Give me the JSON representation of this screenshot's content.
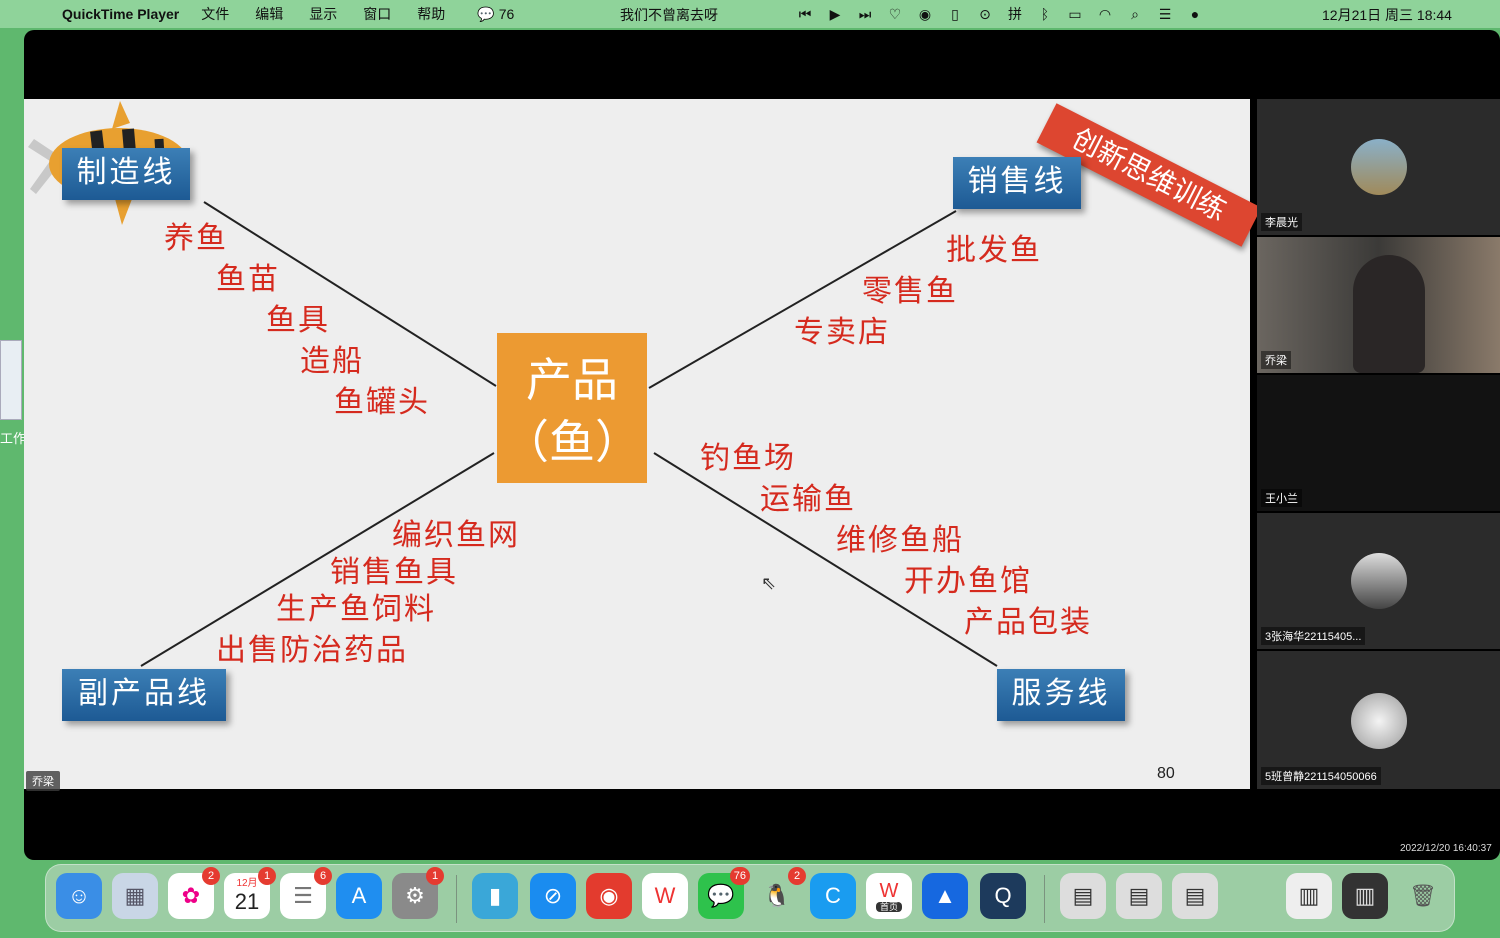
{
  "menubar": {
    "app_name": "QuickTime Player",
    "menus": [
      "文件",
      "编辑",
      "显示",
      "窗口",
      "帮助"
    ],
    "wechat_count": "76",
    "song_title": "我们不曾离去呀",
    "clock": "12月21日 周三  18:44"
  },
  "desktop": {
    "side_label": "工作"
  },
  "slide": {
    "banner": "创新思维训练",
    "center_title": "产品",
    "center_subtitle": "（鱼）",
    "page_number": "80",
    "speaker_tag": "乔梁",
    "manufacturing": {
      "label": "制造线",
      "items": [
        "养鱼",
        "鱼苗",
        "鱼具",
        "造船",
        "鱼罐头"
      ]
    },
    "sales": {
      "label": "销售线",
      "items": [
        "批发鱼",
        "零售鱼",
        "专卖店"
      ]
    },
    "byproduct": {
      "label": "副产品线",
      "items": [
        "编织鱼网",
        "销售鱼具",
        "生产鱼饲料",
        "出售防治药品"
      ]
    },
    "service": {
      "label": "服务线",
      "items": [
        "钓鱼场",
        "运输鱼",
        "维修鱼船",
        "开办鱼馆",
        "产品包装"
      ]
    }
  },
  "participants": [
    {
      "name": "李晨光"
    },
    {
      "name": "乔梁"
    },
    {
      "name": "王小兰"
    },
    {
      "name": "3张海华22115405..."
    },
    {
      "name": "5班曾静221154050066"
    }
  ],
  "recording_timestamp": "2022/12/20 16:40:37",
  "dock": {
    "badges": {
      "photos": "2",
      "calendar": "1",
      "reminders": "6",
      "settings": "1",
      "wechat": "76",
      "qq": "2"
    },
    "calendar_month": "12月",
    "calendar_day": "21",
    "wps_label": "首页"
  },
  "colors": {
    "menubar": "#8fd39a",
    "slide_text": "#d52a1e",
    "center_box": "#ec9a32",
    "blue_label": "#2a6aa6",
    "banner": "#dd4630"
  }
}
